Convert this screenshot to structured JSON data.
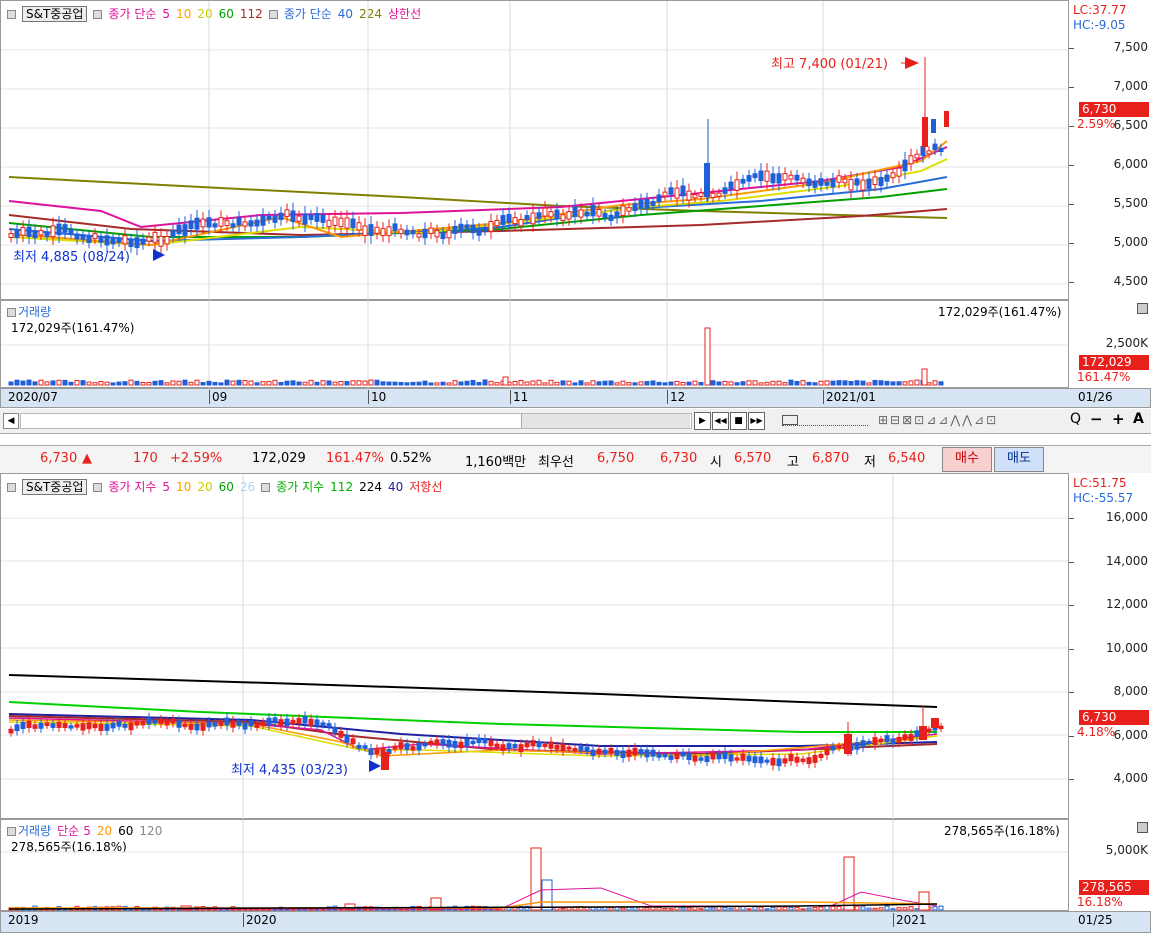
{
  "top_chart": {
    "legend": {
      "stock_name": "S&T중공업",
      "ma_label": "종가 단순",
      "ma_values": [
        "5",
        "10",
        "20",
        "60",
        "112"
      ],
      "ma_colors": [
        "#e0119a",
        "#ff9900",
        "#dddd00",
        "#00a000",
        "#a52a2a"
      ],
      "ma2_label": "종가 단순",
      "ma2_values": [
        "40",
        "224"
      ],
      "ma2_colors": [
        "#2a6bd8",
        "#808000"
      ],
      "extra": "상한선"
    },
    "lc": "LC:37.77",
    "hc": "HC:-9.05",
    "price_ticks": [
      "7,500",
      "7,000",
      "6,500",
      "6,000",
      "5,500",
      "5,000",
      "4,500"
    ],
    "current_price": "6,730",
    "current_pct": "2.59%",
    "high_annotation": "최고 7,400 (01/21)",
    "low_annotation": "최저 4,885 (08/24)",
    "volume_legend": "거래량",
    "volume_left": "172,029주(161.47%)",
    "volume_right": "172,029주(161.47%)",
    "volume_tick": "2,500K",
    "volume_box": "172,029",
    "volume_pct": "161.47%",
    "dates": [
      "2020/07",
      "09",
      "10",
      "11",
      "12",
      "2021/01"
    ],
    "last_date": "01/26"
  },
  "ticker": {
    "price": "6,730",
    "arrow": "▲",
    "change": "170",
    "change_pct": "+2.59%",
    "volume": "172,029",
    "volume_pct": "161.47%",
    "turnover_pct": "0.52%",
    "amount": "1,160백만",
    "best_label": "최우선",
    "ask": "6,750",
    "bid": "6,730",
    "open_label": "시",
    "open": "6,570",
    "high_label": "고",
    "high": "6,870",
    "low_label": "저",
    "low": "6,540",
    "buy_label": "매수",
    "sell_label": "매도"
  },
  "bottom_chart": {
    "legend": {
      "stock_name": "S&T중공업",
      "ma_label": "종가 지수",
      "ma_values": [
        "5",
        "10",
        "20",
        "60",
        "26"
      ],
      "ma_colors": [
        "#e0119a",
        "#ff9900",
        "#dddd00",
        "#00a000",
        "#a0d8ff"
      ],
      "ma2_label": "종가 지수",
      "ma2_values": [
        "112",
        "224",
        "40"
      ],
      "ma2_colors": [
        "#00c000",
        "#000000",
        "#2020a0"
      ],
      "extra": "저항선"
    },
    "lc": "LC:51.75",
    "hc": "HC:-55.57",
    "price_ticks": [
      "16,000",
      "14,000",
      "12,000",
      "10,000",
      "8,000",
      "6,000",
      "4,000"
    ],
    "current_price": "6,730",
    "current_pct": "4.18%",
    "low_annotation": "최저 4,435 (03/23)",
    "volume_legend": "거래량",
    "volume_ma_label": "단순",
    "volume_ma_values": [
      "5",
      "20",
      "60",
      "120"
    ],
    "volume_left": "278,565주(16.18%)",
    "volume_right": "278,565주(16.18%)",
    "volume_tick": "5,000K",
    "volume_box": "278,565",
    "volume_pct": "16.18%",
    "dates": [
      "2019",
      "2020",
      "2021"
    ],
    "last_date": "01/25"
  },
  "toolbar": {
    "scroll_left": "◀",
    "btn_next": "▶",
    "btn_prev_all": "◀◀",
    "btn_stop": "■",
    "btn_fwd_all": "▶▶",
    "zoom_out": "−",
    "zoom_in": "+",
    "text_tool": "A",
    "search": "Q"
  }
}
